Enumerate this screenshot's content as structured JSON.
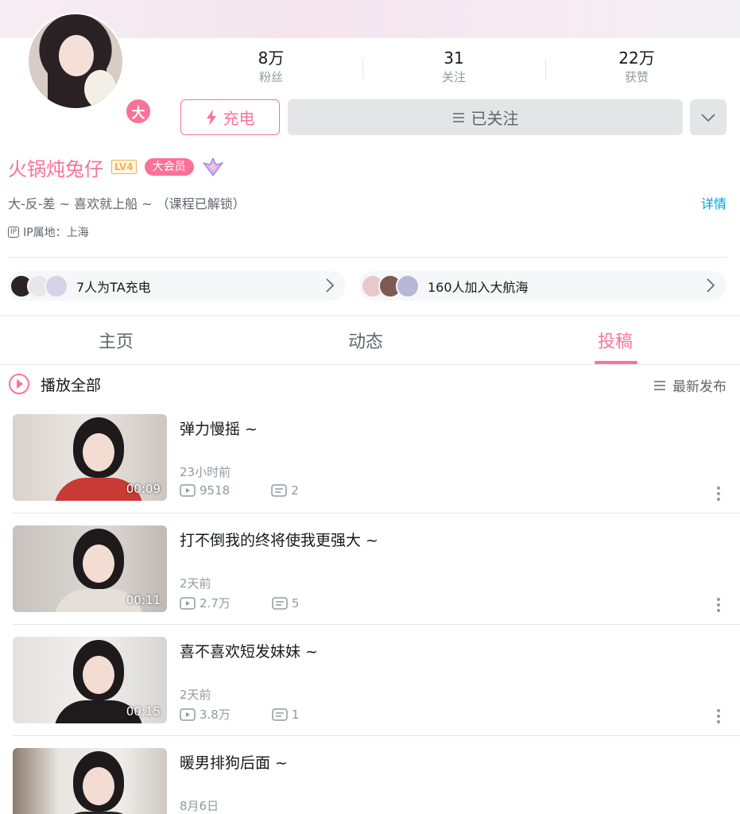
{
  "profile": {
    "avatar_badge": "大",
    "stats": [
      {
        "num": "8万",
        "label": "粉丝"
      },
      {
        "num": "31",
        "label": "关注"
      },
      {
        "num": "22万",
        "label": "获赞"
      }
    ],
    "charge_label": "充电",
    "follow_label": "已关注",
    "name": "火锅炖兔仔",
    "level": "LV4",
    "vip_label": "大会员",
    "signature": "大-反-差 ~ 喜欢就上船 ~ （课程已解锁）",
    "detail_label": "详情",
    "ip_icon": "IP",
    "ip_location": "IP属地：上海"
  },
  "supporters": {
    "charge_text": "7人为TA充电",
    "fleet_text": "160人加入大航海"
  },
  "tabs": [
    {
      "label": "主页"
    },
    {
      "label": "动态"
    },
    {
      "label": "投稿"
    }
  ],
  "list_header": {
    "play_all": "播放全部",
    "sort": "最新发布"
  },
  "videos": [
    {
      "title": "弹力慢摇 ~",
      "time": "23小时前",
      "views": "9518",
      "comments": "2",
      "duration": "00:09"
    },
    {
      "title": "打不倒我的终将使我更强大 ~",
      "time": "2天前",
      "views": "2.7万",
      "comments": "5",
      "duration": "00:11"
    },
    {
      "title": "喜不喜欢短发妹妹 ~",
      "time": "2天前",
      "views": "3.8万",
      "comments": "1",
      "duration": "00:15"
    },
    {
      "title": "暖男排狗后面 ~",
      "time": "8月6日",
      "views": "",
      "comments": "",
      "duration": ""
    }
  ],
  "colors": {
    "accent": "#fb7299",
    "link": "#00a1d6",
    "muted": "#9499a0"
  },
  "icons": [
    "lightning-icon",
    "menu-lines-icon",
    "chevron-down-icon",
    "chevron-right-icon",
    "play-circle-icon",
    "sort-list-icon",
    "play-count-icon",
    "comment-icon",
    "more-vertical-icon"
  ]
}
